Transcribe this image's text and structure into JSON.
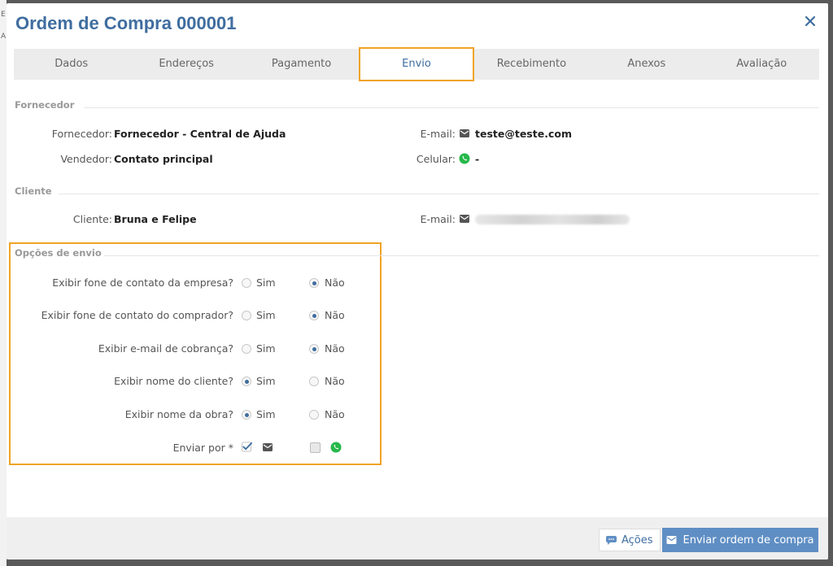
{
  "window": {
    "title": "Ordem de Compra 000001"
  },
  "tabs": [
    {
      "label": "Dados"
    },
    {
      "label": "Endereços"
    },
    {
      "label": "Pagamento"
    },
    {
      "label": "Envio",
      "active": true
    },
    {
      "label": "Recebimento"
    },
    {
      "label": "Anexos"
    },
    {
      "label": "Avaliação"
    }
  ],
  "fornecedor": {
    "section_title": "Fornecedor",
    "fornecedor_label": "Fornecedor:",
    "fornecedor_value": "Fornecedor - Central de Ajuda",
    "vendedor_label": "Vendedor:",
    "vendedor_value": "Contato principal",
    "email_label": "E-mail:",
    "email_value": "teste@teste.com",
    "celular_label": "Celular:",
    "celular_value": "-"
  },
  "cliente": {
    "section_title": "Cliente",
    "cliente_label": "Cliente:",
    "cliente_value": "Bruna e Felipe",
    "email_label": "E-mail:"
  },
  "opcoes": {
    "section_title": "Opções de envio",
    "sim_label": "Sim",
    "nao_label": "Não",
    "questions": [
      {
        "label": "Exibir fone de contato da empresa?",
        "selected": "Não"
      },
      {
        "label": "Exibir fone de contato do comprador?",
        "selected": "Não"
      },
      {
        "label": "Exibir e-mail de cobrança?",
        "selected": "Não"
      },
      {
        "label": "Exibir nome do cliente?",
        "selected": "Sim"
      },
      {
        "label": "Exibir nome da obra?",
        "selected": "Sim"
      }
    ],
    "enviar_por_label": "Enviar por *",
    "enviar_por": {
      "email": true,
      "whatsapp": false
    }
  },
  "footer": {
    "acoes_label": "Ações",
    "enviar_label": "Enviar ordem de compra"
  },
  "colors": {
    "accent_blue": "#3f6d9f",
    "highlight_orange": "#f0a326",
    "button_blue": "#5f8ec4",
    "whatsapp_green": "#25b84a"
  },
  "icons": {
    "close": "close-icon",
    "email": "envelope-icon",
    "whatsapp": "whatsapp-icon",
    "actions": "chat-bubble-icon"
  }
}
